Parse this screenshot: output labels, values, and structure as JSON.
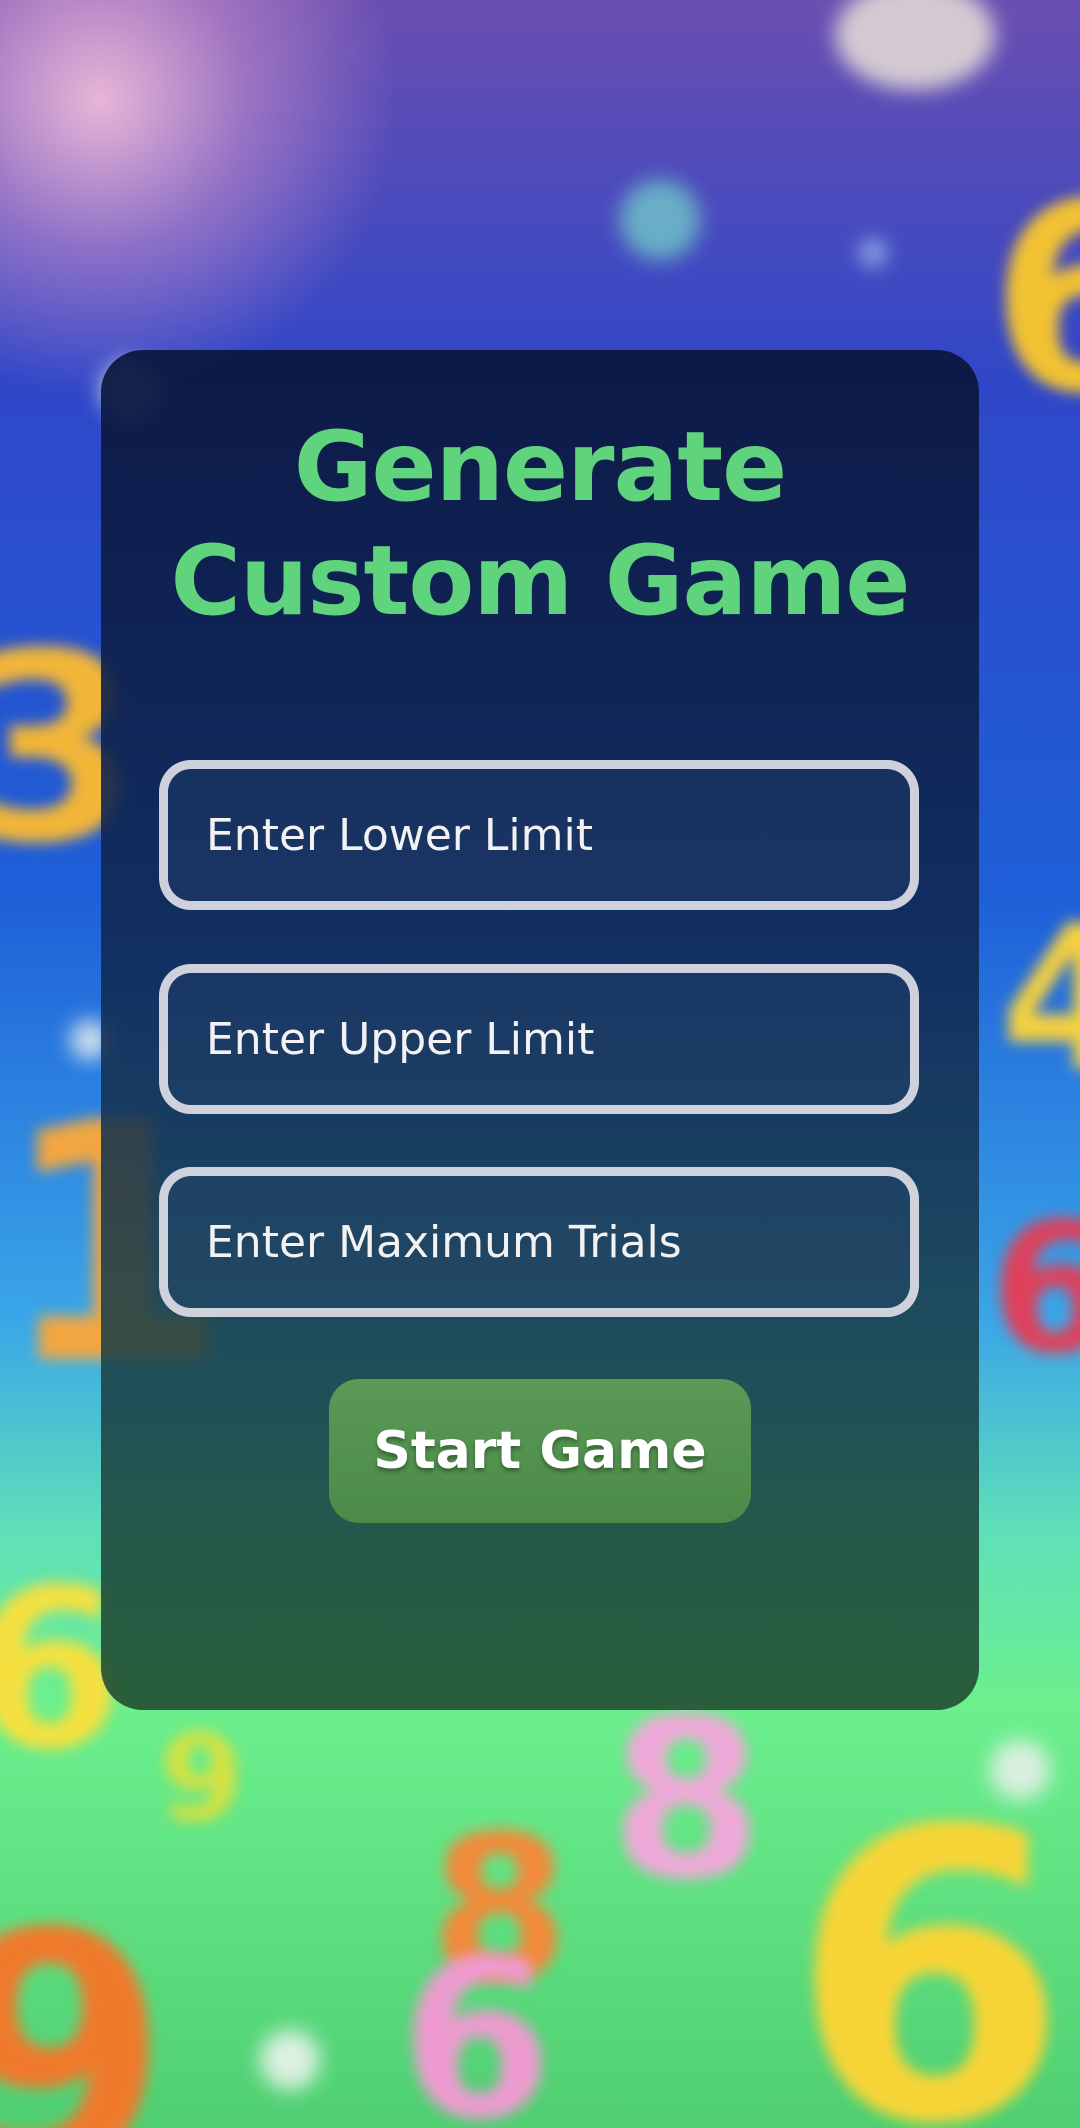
{
  "card": {
    "title_line1": "Generate",
    "title_line2": "Custom Game"
  },
  "form": {
    "lower_limit_placeholder": "Enter Lower Limit",
    "upper_limit_placeholder": "Enter Upper Limit",
    "max_trials_placeholder": "Enter Maximum Trials"
  },
  "actions": {
    "start_label": "Start Game"
  },
  "colors": {
    "title": "#5fd47c",
    "button": "#4f8f4b",
    "field_border": "#dedee6"
  }
}
